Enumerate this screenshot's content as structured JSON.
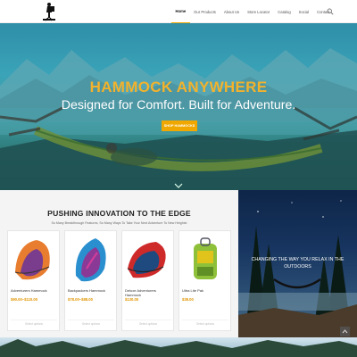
{
  "header": {
    "logo_icon": "hiker-logo-icon",
    "nav": [
      {
        "label": "Home",
        "active": true
      },
      {
        "label": "Our Products"
      },
      {
        "label": "About Us"
      },
      {
        "label": "Store Locator"
      },
      {
        "label": "Catalog"
      },
      {
        "label": "Social"
      },
      {
        "label": "Contact"
      }
    ],
    "search_icon": "search-icon"
  },
  "hero": {
    "title": "HAMMOCK ANYWHERE",
    "subtitle": "Designed for Comfort. Built for Adventure.",
    "button_label": "SHOP HAMMOCKS",
    "scroll_icon": "chevron-down-icon"
  },
  "products": {
    "title": "PUSHING INNOVATION TO THE EDGE",
    "subtitle": "So Many Breakthrough Features, So Many Ways To Take Your Next Adventure To New Heights!",
    "items": [
      {
        "name": "Adventurers Hammock",
        "price": "$90.00–$110.00",
        "action": "Select options"
      },
      {
        "name": "Backpackers Hammock",
        "price": "$78.00–$88.00",
        "action": "Select options"
      },
      {
        "name": "Deluxe Adventurers Hammock",
        "price": "$130.00",
        "action": "Select options"
      },
      {
        "name": "Ultra Lite Pak",
        "price": "$38.00",
        "action": "Select options"
      }
    ]
  },
  "promo": {
    "text": "CHANGING THE WAY YOU RELAX IN THE OUTDOORS"
  },
  "colors": {
    "accent": "#f0a800",
    "hero_title": "#f2b22c"
  }
}
